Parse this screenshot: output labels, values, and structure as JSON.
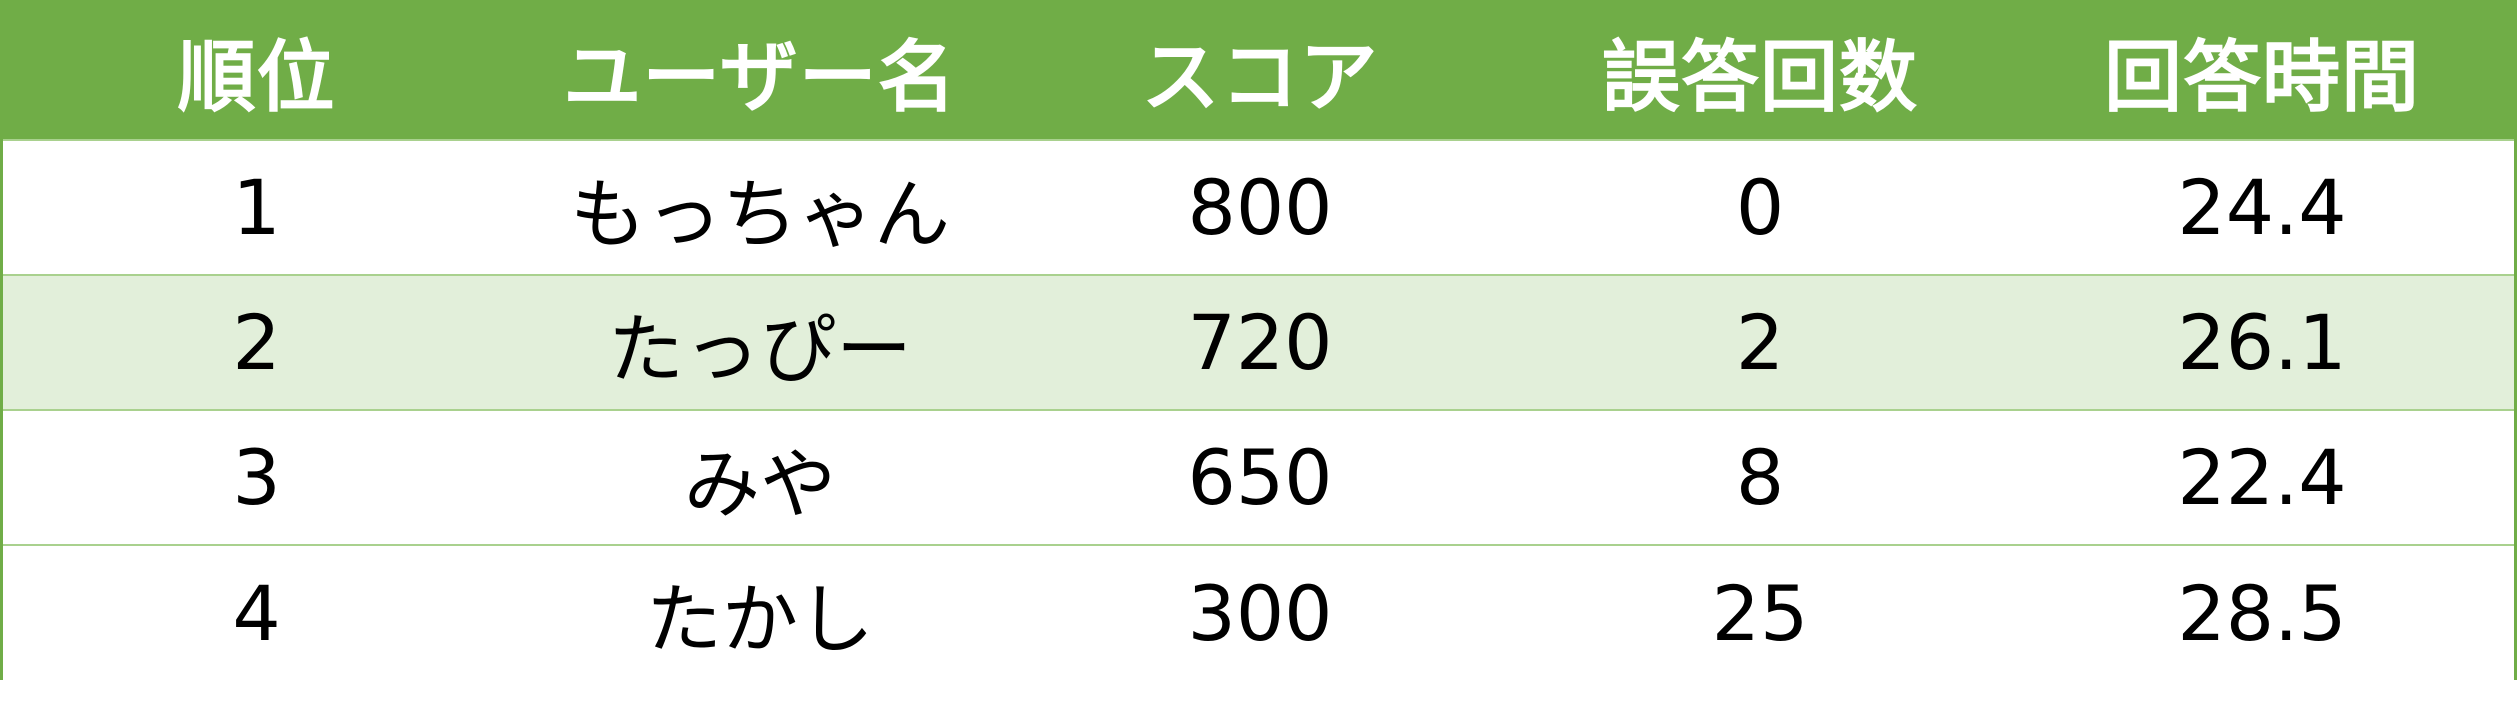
{
  "table": {
    "headers": [
      "順位",
      "ユーザー名",
      "スコア",
      "誤答回数",
      "回答時間"
    ],
    "rows": [
      {
        "rank": "1",
        "user": "もっちゃん",
        "score": "800",
        "wrong": "0",
        "time": "24.4"
      },
      {
        "rank": "2",
        "user": "たっぴー",
        "score": "720",
        "wrong": "2",
        "time": "26.1"
      },
      {
        "rank": "3",
        "user": "みや",
        "score": "650",
        "wrong": "8",
        "time": "22.4"
      },
      {
        "rank": "4",
        "user": "たかし",
        "score": "300",
        "wrong": "25",
        "time": "28.5"
      }
    ]
  },
  "colors": {
    "header_bg": "#70ad47",
    "header_text": "#ffffff",
    "band_bg": "#e2efda",
    "row_bg": "#ffffff",
    "border": "#70ad47"
  }
}
